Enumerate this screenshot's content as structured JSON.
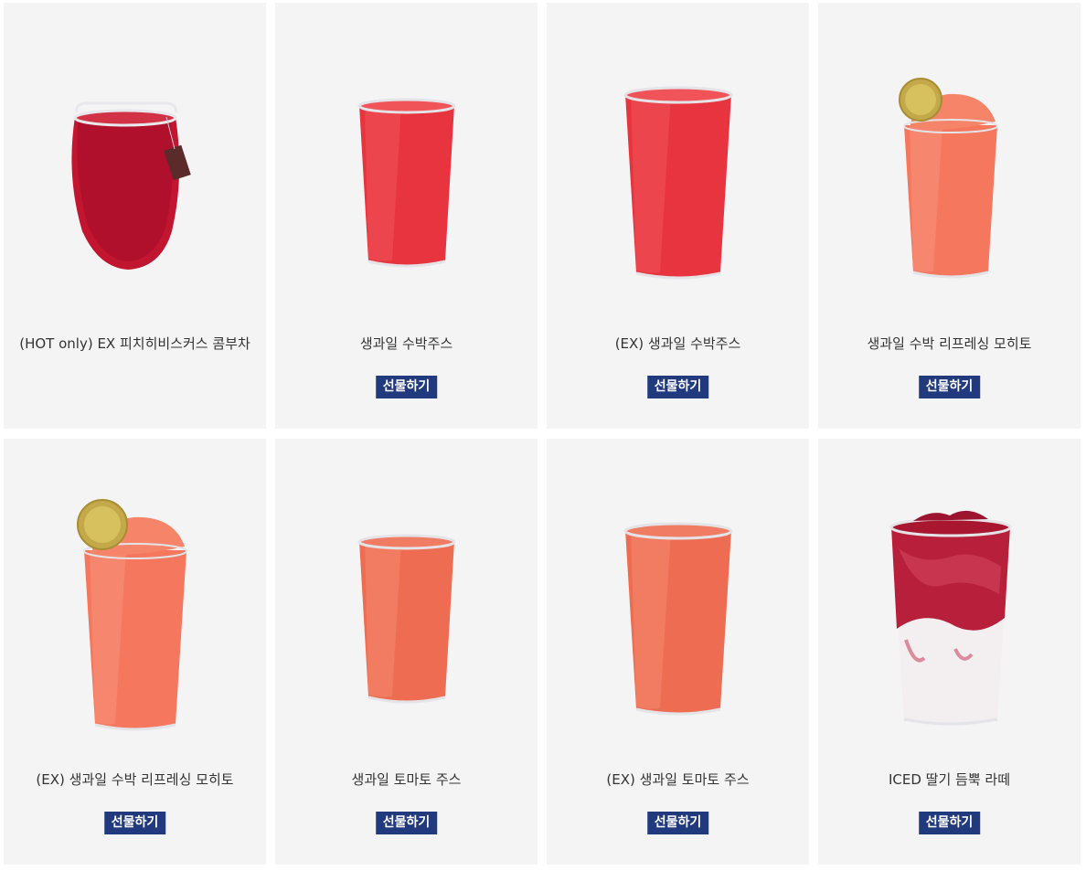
{
  "products": [
    {
      "name": "(HOT only) EX 피치히비스커스 콤부차",
      "gift_label": "",
      "image": "hibiscus-tea-mug",
      "color": "#b7112b"
    },
    {
      "name": "생과일 수박주스",
      "gift_label": "선물하기",
      "image": "watermelon-juice-cup",
      "color": "#e8343e"
    },
    {
      "name": "(EX) 생과일 수박주스",
      "gift_label": "선물하기",
      "image": "watermelon-juice-cup-large",
      "color": "#e8343e"
    },
    {
      "name": "생과일 수박 리프레싱 모히토",
      "gift_label": "선물하기",
      "image": "watermelon-mojito-cup",
      "color": "#f4775e"
    },
    {
      "name": "(EX) 생과일 수박 리프레싱 모히토",
      "gift_label": "선물하기",
      "image": "watermelon-mojito-cup-large",
      "color": "#f4775e"
    },
    {
      "name": "생과일 토마토 주스",
      "gift_label": "선물하기",
      "image": "tomato-juice-cup",
      "color": "#ee6d52"
    },
    {
      "name": "(EX) 생과일 토마토 주스",
      "gift_label": "선물하기",
      "image": "tomato-juice-cup-large",
      "color": "#ee6d52"
    },
    {
      "name": "ICED 딸기 듬뿍 라떼",
      "gift_label": "선물하기",
      "image": "strawberry-latte-cup",
      "color": "#b81f3a"
    }
  ],
  "colors": {
    "card_bg": "#f4f4f5",
    "gift_bg": "#213a7e",
    "text": "#333333"
  }
}
